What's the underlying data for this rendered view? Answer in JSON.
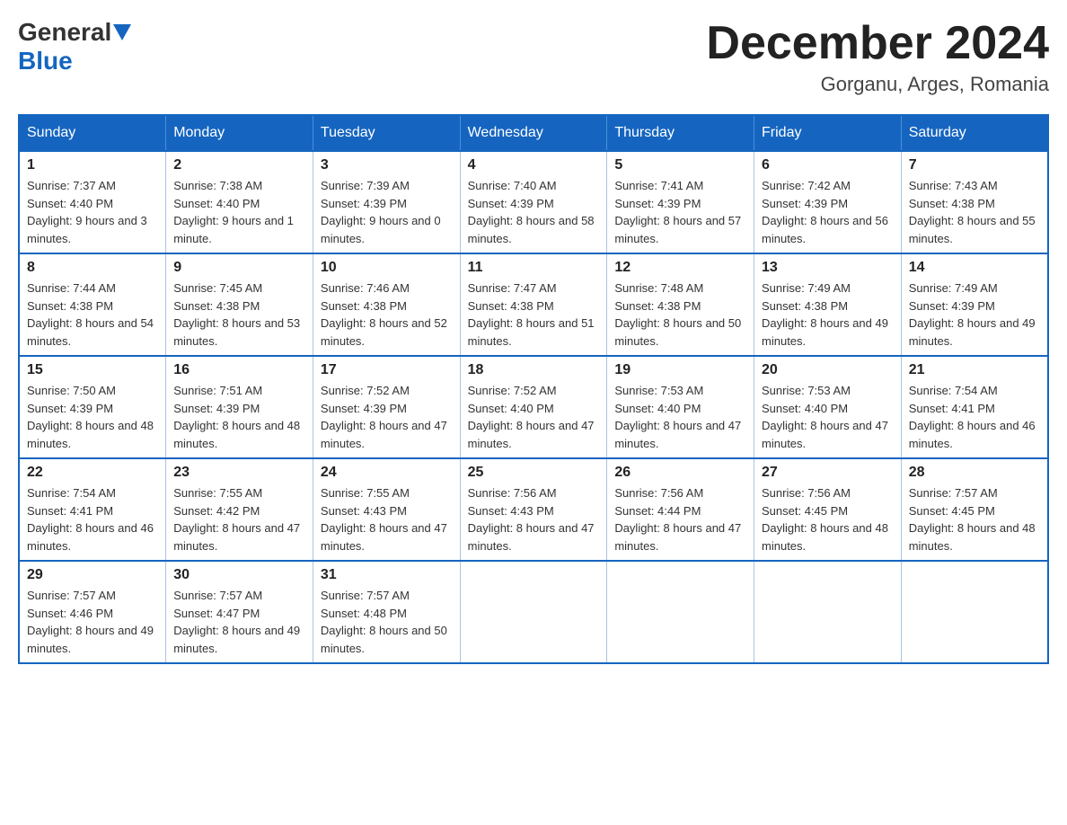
{
  "header": {
    "logo": {
      "general": "General",
      "blue": "Blue"
    },
    "title": "December 2024",
    "location": "Gorganu, Arges, Romania"
  },
  "columns": [
    "Sunday",
    "Monday",
    "Tuesday",
    "Wednesday",
    "Thursday",
    "Friday",
    "Saturday"
  ],
  "weeks": [
    [
      {
        "day": "1",
        "sunrise": "7:37 AM",
        "sunset": "4:40 PM",
        "daylight": "9 hours and 3 minutes."
      },
      {
        "day": "2",
        "sunrise": "7:38 AM",
        "sunset": "4:40 PM",
        "daylight": "9 hours and 1 minute."
      },
      {
        "day": "3",
        "sunrise": "7:39 AM",
        "sunset": "4:39 PM",
        "daylight": "9 hours and 0 minutes."
      },
      {
        "day": "4",
        "sunrise": "7:40 AM",
        "sunset": "4:39 PM",
        "daylight": "8 hours and 58 minutes."
      },
      {
        "day": "5",
        "sunrise": "7:41 AM",
        "sunset": "4:39 PM",
        "daylight": "8 hours and 57 minutes."
      },
      {
        "day": "6",
        "sunrise": "7:42 AM",
        "sunset": "4:39 PM",
        "daylight": "8 hours and 56 minutes."
      },
      {
        "day": "7",
        "sunrise": "7:43 AM",
        "sunset": "4:38 PM",
        "daylight": "8 hours and 55 minutes."
      }
    ],
    [
      {
        "day": "8",
        "sunrise": "7:44 AM",
        "sunset": "4:38 PM",
        "daylight": "8 hours and 54 minutes."
      },
      {
        "day": "9",
        "sunrise": "7:45 AM",
        "sunset": "4:38 PM",
        "daylight": "8 hours and 53 minutes."
      },
      {
        "day": "10",
        "sunrise": "7:46 AM",
        "sunset": "4:38 PM",
        "daylight": "8 hours and 52 minutes."
      },
      {
        "day": "11",
        "sunrise": "7:47 AM",
        "sunset": "4:38 PM",
        "daylight": "8 hours and 51 minutes."
      },
      {
        "day": "12",
        "sunrise": "7:48 AM",
        "sunset": "4:38 PM",
        "daylight": "8 hours and 50 minutes."
      },
      {
        "day": "13",
        "sunrise": "7:49 AM",
        "sunset": "4:38 PM",
        "daylight": "8 hours and 49 minutes."
      },
      {
        "day": "14",
        "sunrise": "7:49 AM",
        "sunset": "4:39 PM",
        "daylight": "8 hours and 49 minutes."
      }
    ],
    [
      {
        "day": "15",
        "sunrise": "7:50 AM",
        "sunset": "4:39 PM",
        "daylight": "8 hours and 48 minutes."
      },
      {
        "day": "16",
        "sunrise": "7:51 AM",
        "sunset": "4:39 PM",
        "daylight": "8 hours and 48 minutes."
      },
      {
        "day": "17",
        "sunrise": "7:52 AM",
        "sunset": "4:39 PM",
        "daylight": "8 hours and 47 minutes."
      },
      {
        "day": "18",
        "sunrise": "7:52 AM",
        "sunset": "4:40 PM",
        "daylight": "8 hours and 47 minutes."
      },
      {
        "day": "19",
        "sunrise": "7:53 AM",
        "sunset": "4:40 PM",
        "daylight": "8 hours and 47 minutes."
      },
      {
        "day": "20",
        "sunrise": "7:53 AM",
        "sunset": "4:40 PM",
        "daylight": "8 hours and 47 minutes."
      },
      {
        "day": "21",
        "sunrise": "7:54 AM",
        "sunset": "4:41 PM",
        "daylight": "8 hours and 46 minutes."
      }
    ],
    [
      {
        "day": "22",
        "sunrise": "7:54 AM",
        "sunset": "4:41 PM",
        "daylight": "8 hours and 46 minutes."
      },
      {
        "day": "23",
        "sunrise": "7:55 AM",
        "sunset": "4:42 PM",
        "daylight": "8 hours and 47 minutes."
      },
      {
        "day": "24",
        "sunrise": "7:55 AM",
        "sunset": "4:43 PM",
        "daylight": "8 hours and 47 minutes."
      },
      {
        "day": "25",
        "sunrise": "7:56 AM",
        "sunset": "4:43 PM",
        "daylight": "8 hours and 47 minutes."
      },
      {
        "day": "26",
        "sunrise": "7:56 AM",
        "sunset": "4:44 PM",
        "daylight": "8 hours and 47 minutes."
      },
      {
        "day": "27",
        "sunrise": "7:56 AM",
        "sunset": "4:45 PM",
        "daylight": "8 hours and 48 minutes."
      },
      {
        "day": "28",
        "sunrise": "7:57 AM",
        "sunset": "4:45 PM",
        "daylight": "8 hours and 48 minutes."
      }
    ],
    [
      {
        "day": "29",
        "sunrise": "7:57 AM",
        "sunset": "4:46 PM",
        "daylight": "8 hours and 49 minutes."
      },
      {
        "day": "30",
        "sunrise": "7:57 AM",
        "sunset": "4:47 PM",
        "daylight": "8 hours and 49 minutes."
      },
      {
        "day": "31",
        "sunrise": "7:57 AM",
        "sunset": "4:48 PM",
        "daylight": "8 hours and 50 minutes."
      },
      null,
      null,
      null,
      null
    ]
  ]
}
